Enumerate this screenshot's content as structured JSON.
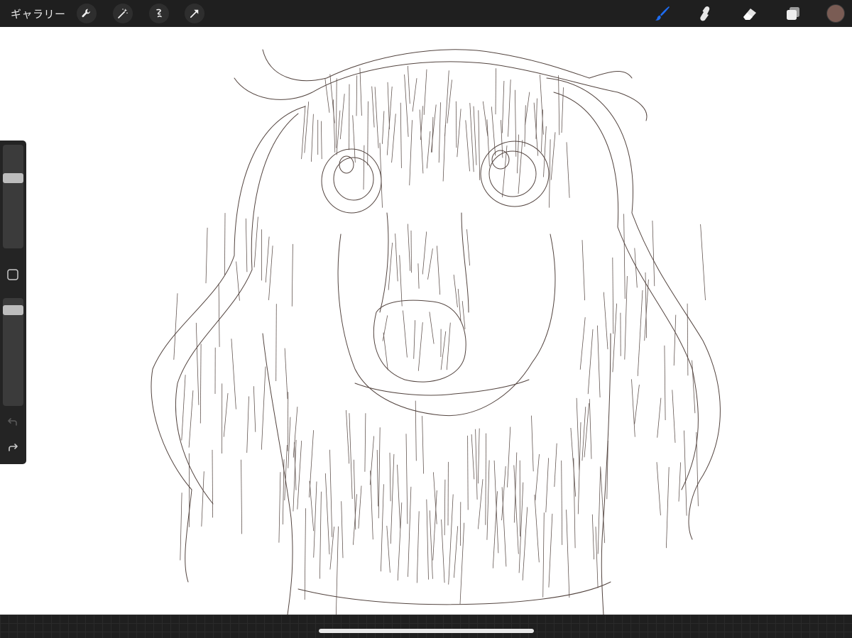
{
  "topbar": {
    "gallery_label": "ギャラリー",
    "left_tools": [
      "wrench-icon",
      "magic-wand-icon",
      "selection-icon",
      "transform-arrow-icon"
    ],
    "right_tools": [
      "paint-brush-icon",
      "smudge-icon",
      "eraser-icon",
      "layers-icon"
    ],
    "active_tool": "paint-brush-icon",
    "active_color": "#7a5c54",
    "accent_color": "#1e6cf0"
  },
  "sidebar": {
    "brush_size_level": 0.7,
    "opacity_level": 0.93,
    "controls": [
      "brush-size-slider",
      "modify-button",
      "opacity-slider",
      "undo-icon",
      "redo-icon"
    ]
  },
  "canvas": {
    "stroke_color": "#4a3a35",
    "content": "sketch-drawing"
  }
}
